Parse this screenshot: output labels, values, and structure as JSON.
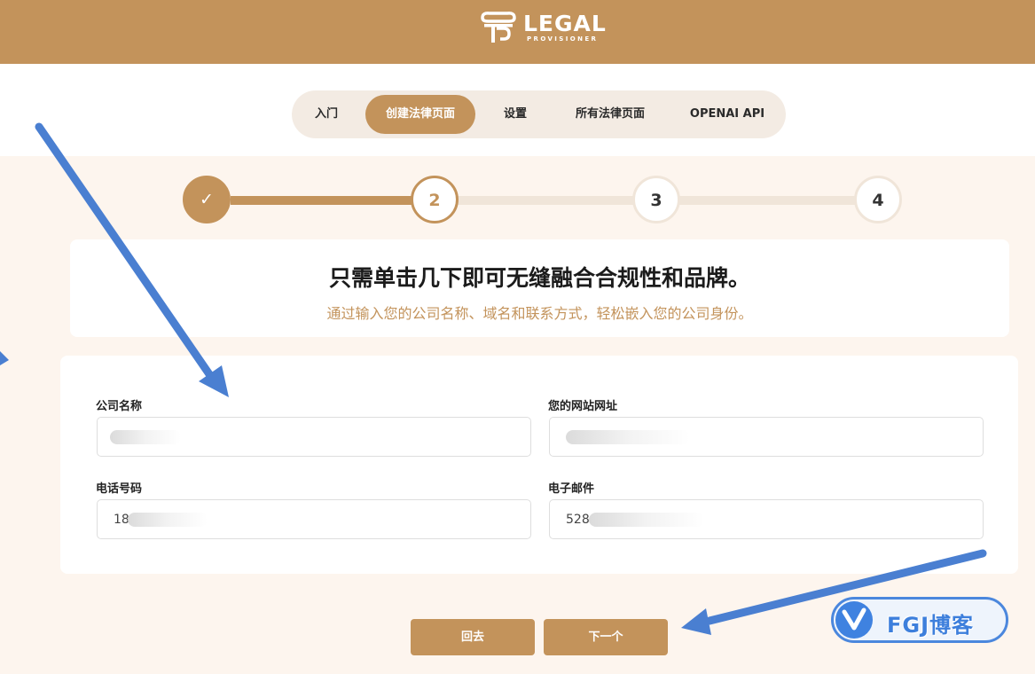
{
  "logo": {
    "main": "LEGAL",
    "sub": "PROVISIONER"
  },
  "nav": {
    "items": [
      {
        "label": "入门"
      },
      {
        "label": "创建法律页面"
      },
      {
        "label": "设置"
      },
      {
        "label": "所有法律页面"
      },
      {
        "label": "OPENAI API"
      }
    ],
    "active": "创建法律页面"
  },
  "stepper": {
    "steps": [
      {
        "label": "✓",
        "state": "complete"
      },
      {
        "label": "2",
        "state": "current"
      },
      {
        "label": "3",
        "state": "pending"
      },
      {
        "label": "4",
        "state": "pending"
      }
    ]
  },
  "hero": {
    "title": "只需单击几下即可无缝融合合规性和品牌。",
    "subtitle": "通过输入您的公司名称、域名和联系方式，轻松嵌入您的公司身份。"
  },
  "form": {
    "company_name": {
      "label": "公司名称",
      "value": ""
    },
    "website": {
      "label": "您的网站网址",
      "value": ""
    },
    "phone": {
      "label": "电话号码",
      "value": "18"
    },
    "email": {
      "label": "电子邮件",
      "value": "528"
    }
  },
  "buttons": {
    "back": "回去",
    "next": "下一个"
  },
  "watermark": {
    "text": "FGJ博客"
  },
  "colors": {
    "brand": "#c3935b",
    "background": "#fdf5ee",
    "arrow": "#4a7fd1",
    "track_inactive": "#f0e5d9"
  }
}
